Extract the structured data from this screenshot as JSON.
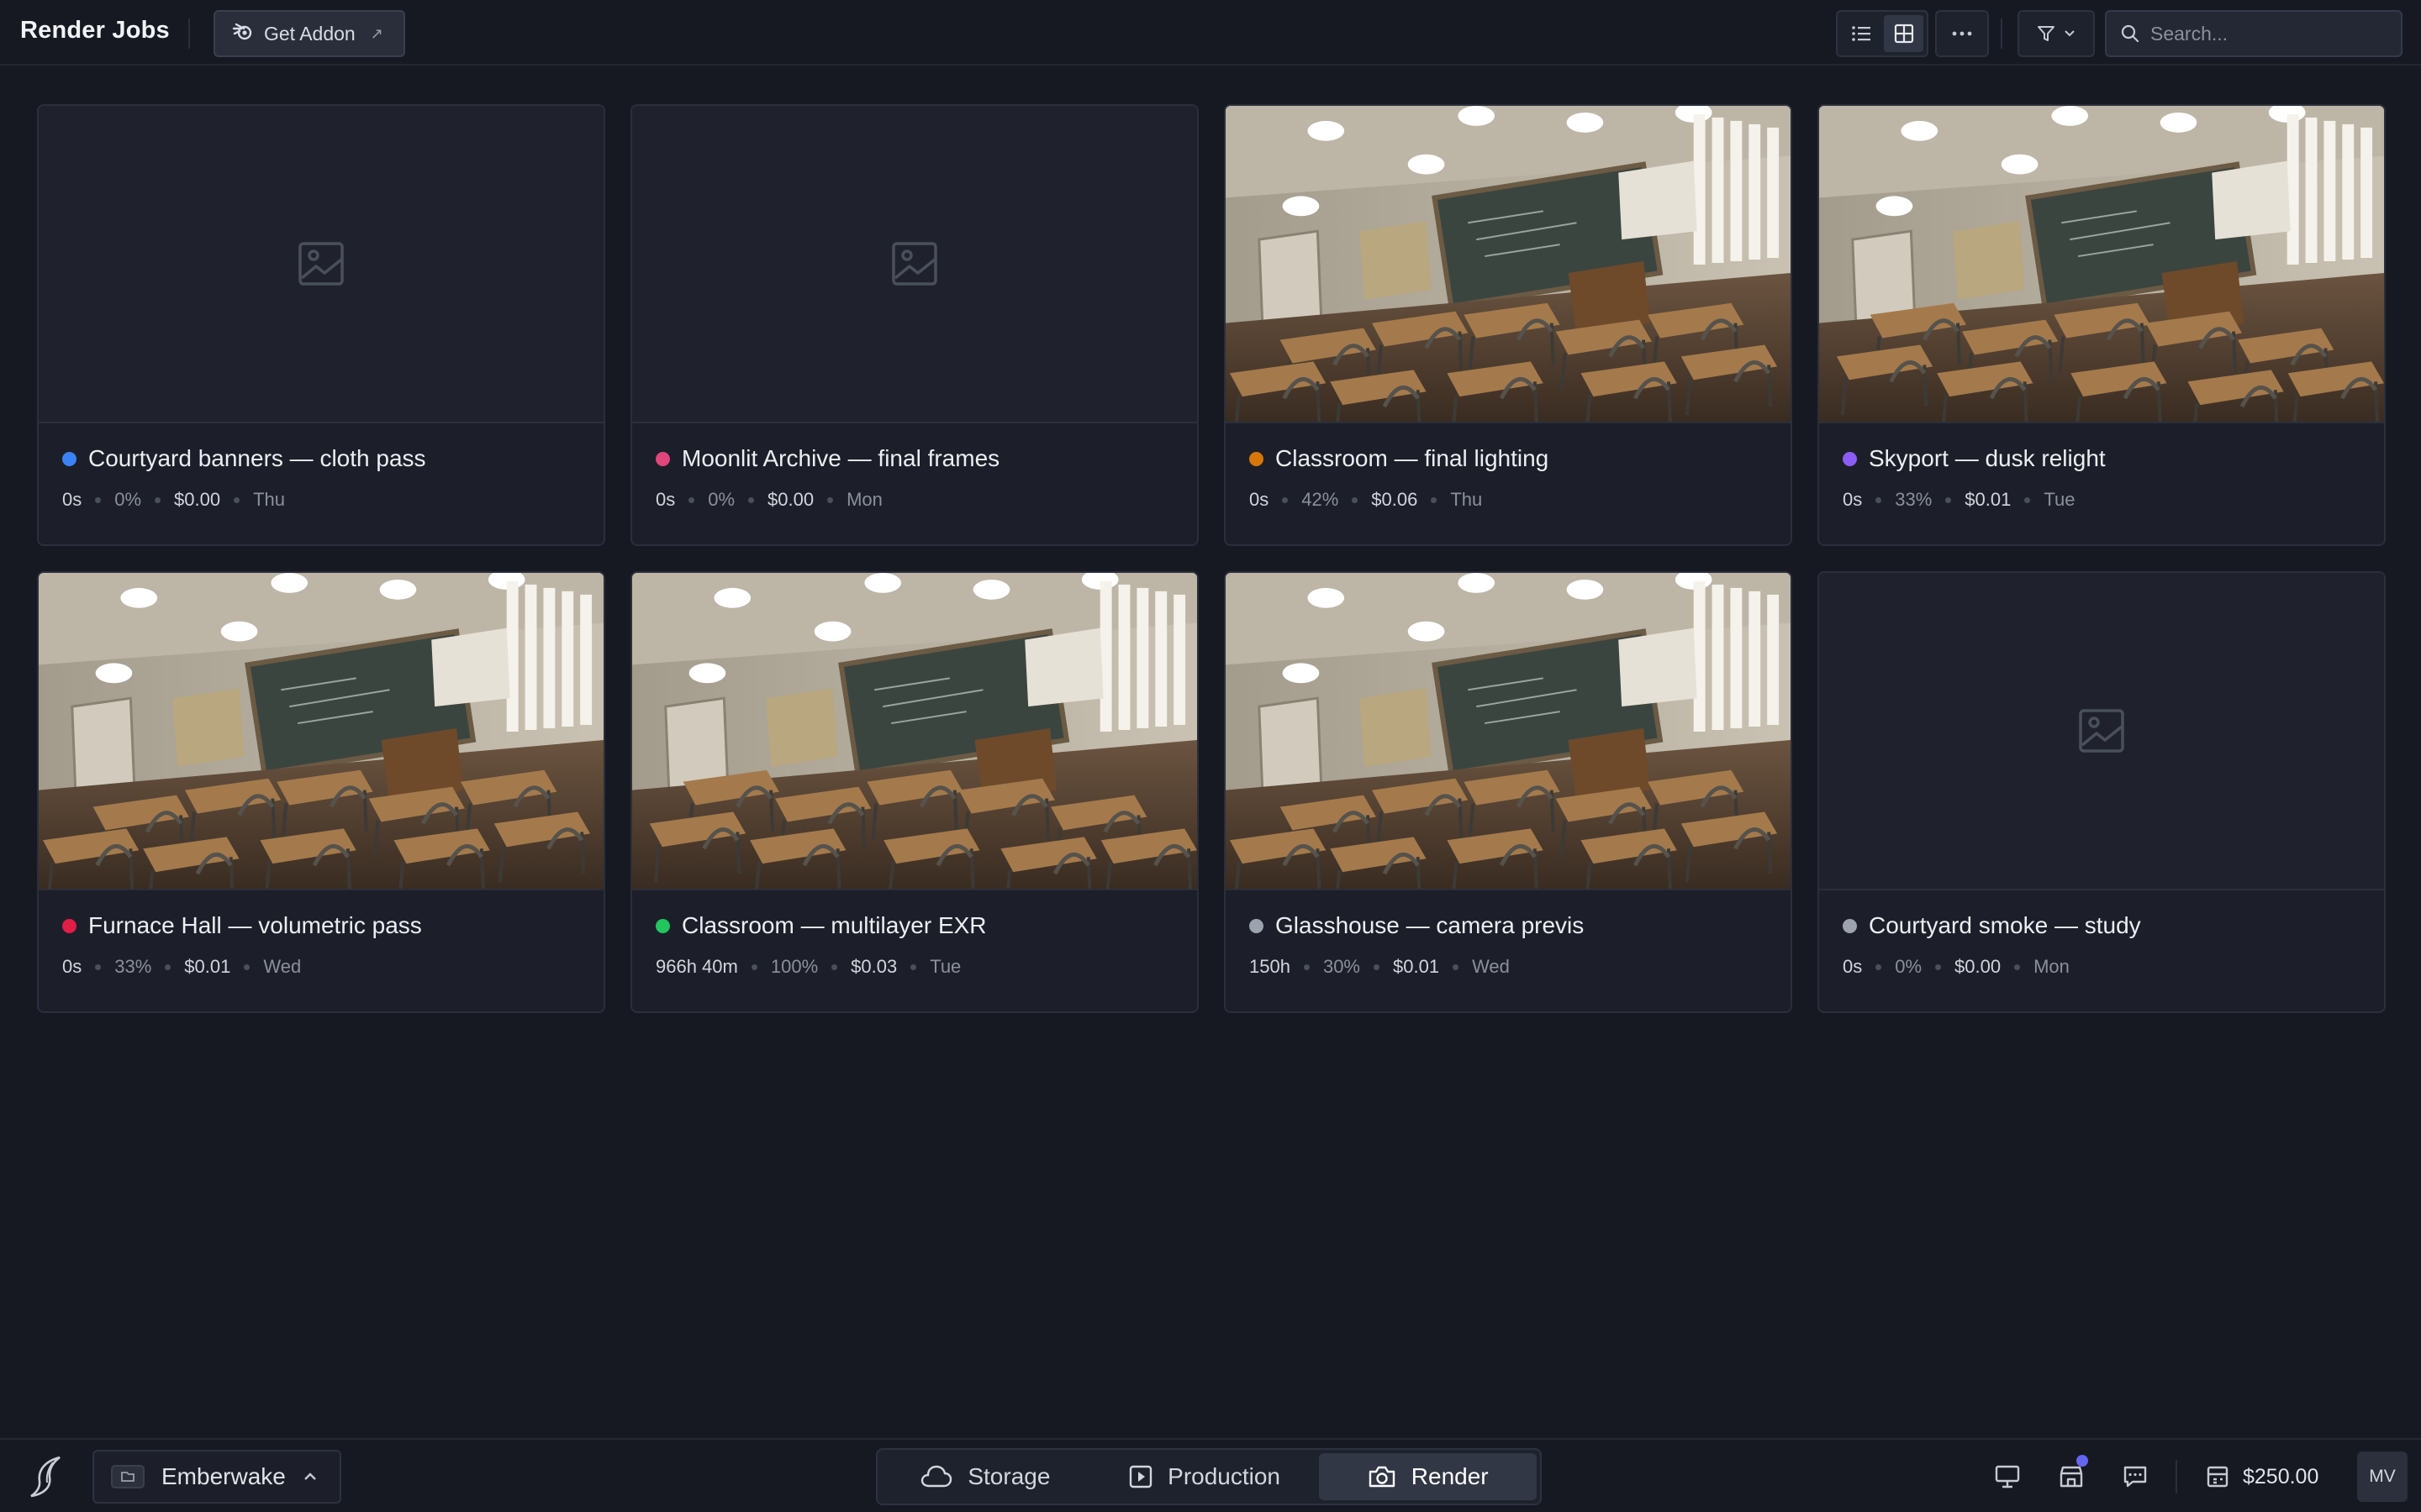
{
  "header": {
    "title": "Render Jobs",
    "addon_label": "Get Addon",
    "search_placeholder": "Search...",
    "view_mode": "grid"
  },
  "jobs": [
    {
      "title": "Courtyard banners — cloth pass",
      "status_color": "#3b82f6",
      "duration": "0s",
      "progress": "0%",
      "cost": "$0.00",
      "day": "Thu",
      "has_preview": false
    },
    {
      "title": "Moonlit Archive — final frames",
      "status_color": "#e0457b",
      "duration": "0s",
      "progress": "0%",
      "cost": "$0.00",
      "day": "Mon",
      "has_preview": false
    },
    {
      "title": "Classroom — final lighting",
      "status_color": "#d97706",
      "duration": "0s",
      "progress": "42%",
      "cost": "$0.06",
      "day": "Thu",
      "has_preview": true
    },
    {
      "title": "Skyport — dusk relight",
      "status_color": "#8b5cf6",
      "duration": "0s",
      "progress": "33%",
      "cost": "$0.01",
      "day": "Tue",
      "has_preview": true
    },
    {
      "title": "Furnace Hall — volumetric pass",
      "status_color": "#e11d48",
      "duration": "0s",
      "progress": "33%",
      "cost": "$0.01",
      "day": "Wed",
      "has_preview": true
    },
    {
      "title": "Classroom — multilayer EXR",
      "status_color": "#22c55e",
      "duration": "966h 40m",
      "progress": "100%",
      "cost": "$0.03",
      "day": "Tue",
      "has_preview": true
    },
    {
      "title": "Glasshouse — camera previs",
      "status_color": "#9ca3af",
      "duration": "150h",
      "progress": "30%",
      "cost": "$0.01",
      "day": "Wed",
      "has_preview": true
    },
    {
      "title": "Courtyard smoke — study",
      "status_color": "#9ca3af",
      "duration": "0s",
      "progress": "0%",
      "cost": "$0.00",
      "day": "Mon",
      "has_preview": false
    }
  ],
  "bottom": {
    "workspace": "Emberwake",
    "nav": [
      {
        "label": "Storage",
        "icon": "cloud-icon",
        "active": false
      },
      {
        "label": "Production",
        "icon": "play-square-icon",
        "active": false
      },
      {
        "label": "Render",
        "icon": "camera-icon",
        "active": true
      }
    ],
    "balance": "$250.00",
    "avatar_initials": "MV",
    "notification_color": "#6366f1"
  }
}
